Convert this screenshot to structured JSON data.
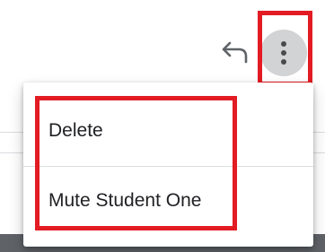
{
  "header": {
    "reply_icon": "reply-arrow-icon",
    "more_icon": "more-vertical-icon"
  },
  "menu": {
    "items": [
      {
        "label": "Delete"
      },
      {
        "label": "Mute Student One"
      }
    ]
  },
  "colors": {
    "highlight": "#e31b23",
    "more_button_bg": "#d2d3d5",
    "text": "#202124",
    "icon": "#5f6368"
  }
}
